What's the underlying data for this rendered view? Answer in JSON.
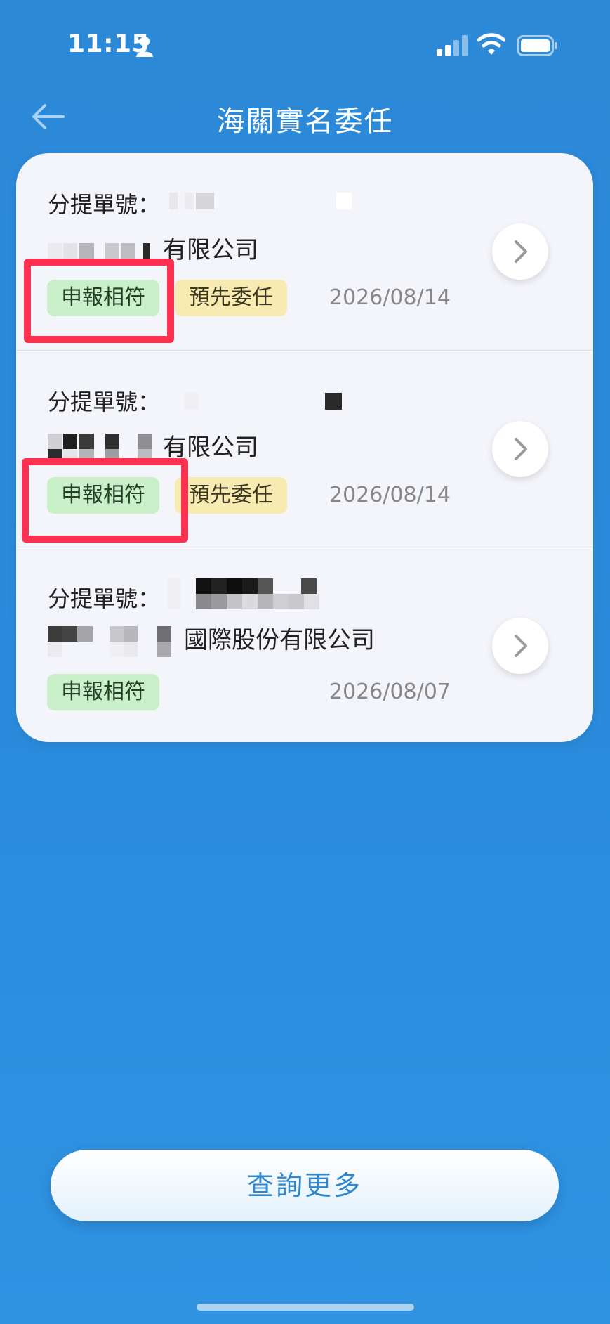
{
  "status_bar": {
    "time": "11:15"
  },
  "header": {
    "title": "海關實名委任"
  },
  "items": [
    {
      "label": "分提單號：",
      "company_suffix": "有限公司",
      "tags": [
        "申報相符",
        "預先委任"
      ],
      "date": "2026/08/14"
    },
    {
      "label": "分提單號：",
      "company_suffix": "有限公司",
      "tags": [
        "申報相符",
        "預先委任"
      ],
      "date": "2026/08/14"
    },
    {
      "label": "分提單號：",
      "company_suffix": "國際股份有限公司",
      "tags": [
        "申報相符"
      ],
      "date": "2026/08/07"
    }
  ],
  "footer": {
    "more_label": "查詢更多"
  },
  "colors": {
    "background": "#2c89d8",
    "tag_green": "#c9f0c9",
    "tag_yellow": "#f7ebb2",
    "highlight": "#ff3150",
    "button_text": "#2f86cc"
  }
}
